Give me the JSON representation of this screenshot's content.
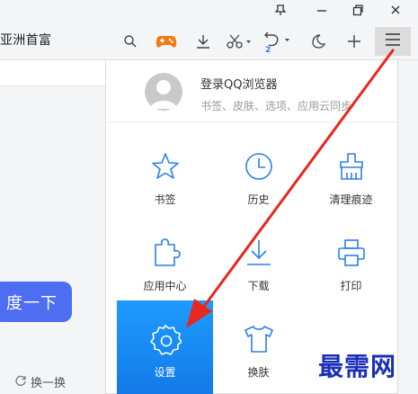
{
  "window": {
    "pin_icon": "pin-icon",
    "minimize_icon": "minimize-icon",
    "restore_icon": "restore-icon",
    "close_icon": "close-icon"
  },
  "toolbar": {
    "address_text": "亚洲首富",
    "icons": [
      "search-icon",
      "gamepad-icon",
      "download-icon",
      "scissors-icon",
      "undo-icon",
      "night-mode-icon",
      "new-tab-icon",
      "menu-icon"
    ],
    "undo_badge": "2",
    "game_color": "#f07b13"
  },
  "page": {
    "search_button_label": "度一下",
    "refresh_label": "换一换",
    "search_button_color": "#4e6ef2"
  },
  "menu": {
    "login_title": "登录QQ浏览器",
    "login_subtitle": "书签、皮肤、选项、应用云同步",
    "items": [
      {
        "label": "书签",
        "icon": "star-icon"
      },
      {
        "label": "历史",
        "icon": "clock-icon"
      },
      {
        "label": "清理痕迹",
        "icon": "broom-icon"
      },
      {
        "label": "应用中心",
        "icon": "puzzle-icon"
      },
      {
        "label": "下载",
        "icon": "download-arrow-icon"
      },
      {
        "label": "打印",
        "icon": "printer-icon"
      },
      {
        "label": "设置",
        "icon": "gear-icon",
        "active": true
      },
      {
        "label": "换肤",
        "icon": "tshirt-icon"
      }
    ],
    "active_color": "#1688f0"
  },
  "overlay": {
    "watermark_text": "最需网",
    "arrow_color": "#e8271e"
  }
}
